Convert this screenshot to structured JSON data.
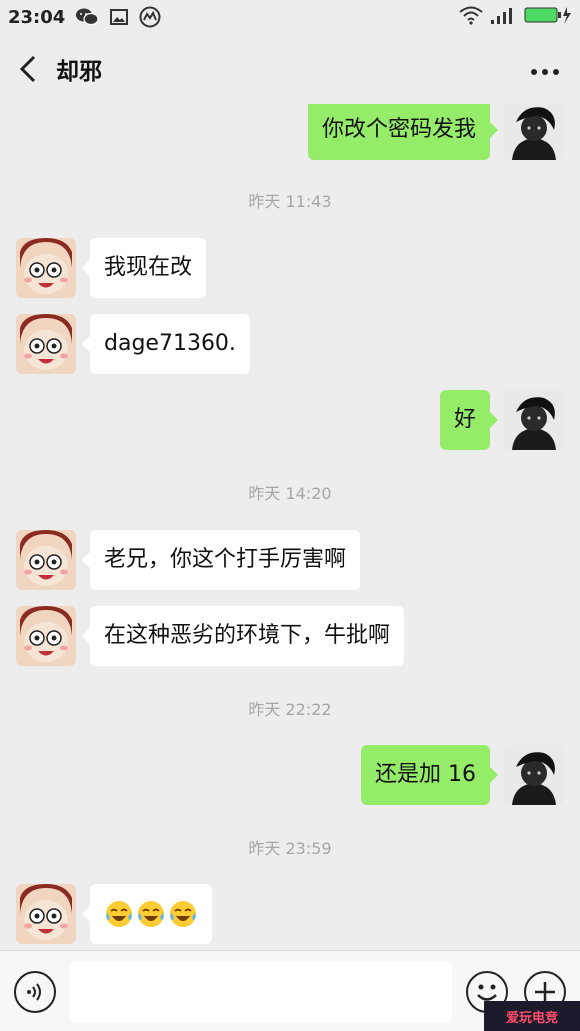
{
  "status_bar": {
    "time": "23:04",
    "icons": [
      "wechat-icon",
      "image-icon",
      "speedometer-icon",
      "wifi-icon",
      "signal-icon",
      "battery-charging-icon"
    ]
  },
  "nav": {
    "title": "却邪",
    "back_icon": "chevron-left-icon",
    "more_icon": "more-dots-icon"
  },
  "messages": [
    {
      "side": "right",
      "text": "你改个密码发我"
    },
    {
      "timestamp": "昨天 11:43"
    },
    {
      "side": "left",
      "text": "我现在改"
    },
    {
      "side": "left",
      "text": "dage71360."
    },
    {
      "side": "right",
      "text": "好"
    },
    {
      "timestamp": "昨天 14:20"
    },
    {
      "side": "left",
      "text": "老兄，你这个打手厉害啊"
    },
    {
      "side": "left",
      "text": "在这种恶劣的环境下，牛批啊"
    },
    {
      "timestamp": "昨天 22:22"
    },
    {
      "side": "right",
      "text": "还是加 16"
    },
    {
      "timestamp": "昨天 23:59"
    },
    {
      "side": "left",
      "emoji": [
        "tears-of-joy-icon",
        "tears-of-joy-icon",
        "tears-of-joy-icon"
      ]
    }
  ],
  "input_bar": {
    "voice_icon": "voice-icon",
    "placeholder": "",
    "emoji_icon": "smiley-icon",
    "plus_icon": "plus-icon"
  },
  "watermark": {
    "text": "爱玩电竞"
  },
  "colors": {
    "background": "#ededed",
    "bubble_sent": "#95ec69",
    "bubble_received": "#ffffff",
    "battery": "#4cd964"
  }
}
